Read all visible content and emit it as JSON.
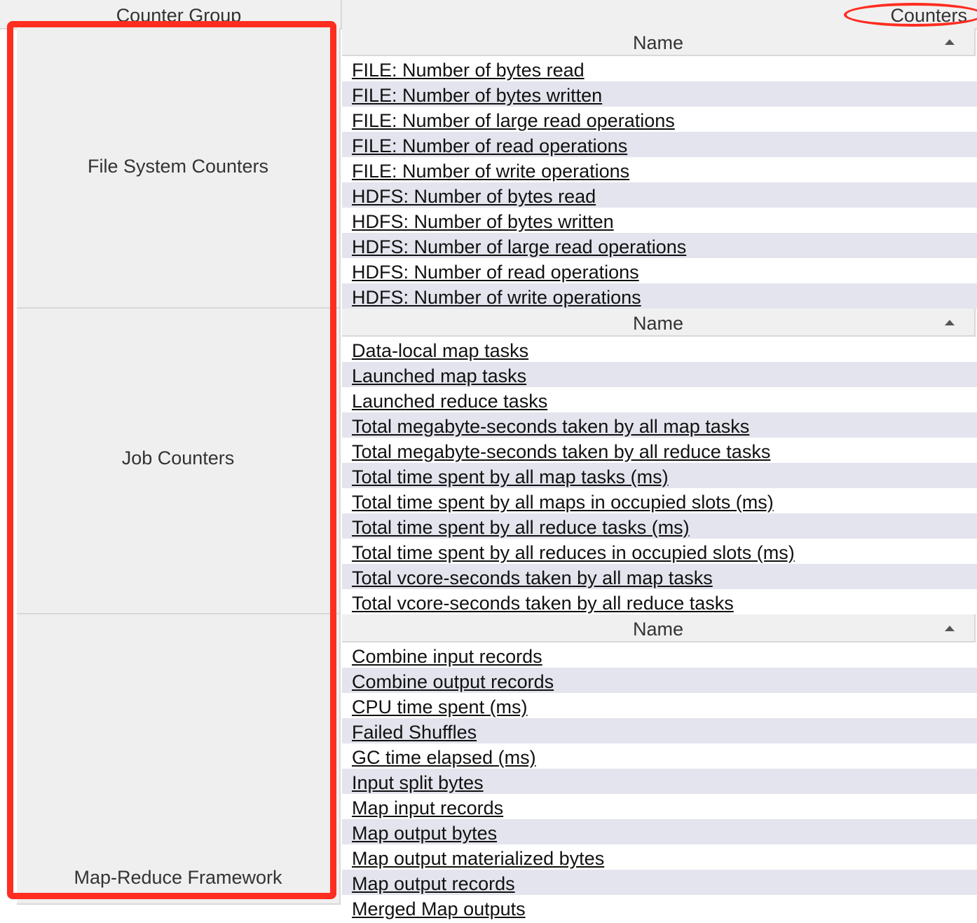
{
  "table": {
    "header": {
      "counter_group": "Counter Group",
      "counters": "Counters"
    },
    "name_column_label": "Name",
    "groups": [
      {
        "label": "File System Counters",
        "counters": [
          "FILE: Number of bytes read",
          "FILE: Number of bytes written",
          "FILE: Number of large read operations",
          "FILE: Number of read operations",
          "FILE: Number of write operations",
          "HDFS: Number of bytes read",
          "HDFS: Number of bytes written",
          "HDFS: Number of large read operations",
          "HDFS: Number of read operations",
          "HDFS: Number of write operations"
        ]
      },
      {
        "label": "Job Counters",
        "counters": [
          "Data-local map tasks",
          "Launched map tasks",
          "Launched reduce tasks",
          "Total megabyte-seconds taken by all map tasks",
          "Total megabyte-seconds taken by all reduce tasks",
          "Total time spent by all map tasks (ms)",
          "Total time spent by all maps in occupied slots (ms)",
          "Total time spent by all reduce tasks (ms)",
          "Total time spent by all reduces in occupied slots (ms)",
          "Total vcore-seconds taken by all map tasks",
          "Total vcore-seconds taken by all reduce tasks"
        ]
      },
      {
        "label": "Map-Reduce Framework",
        "counters": [
          "Combine input records",
          "Combine output records",
          "CPU time spent (ms)",
          "Failed Shuffles",
          "GC time elapsed (ms)",
          "Input split bytes",
          "Map input records",
          "Map output bytes",
          "Map output materialized bytes",
          "Map output records",
          "Merged Map outputs"
        ]
      }
    ]
  },
  "annotations": {
    "highlight_color": "#ff2d20"
  }
}
